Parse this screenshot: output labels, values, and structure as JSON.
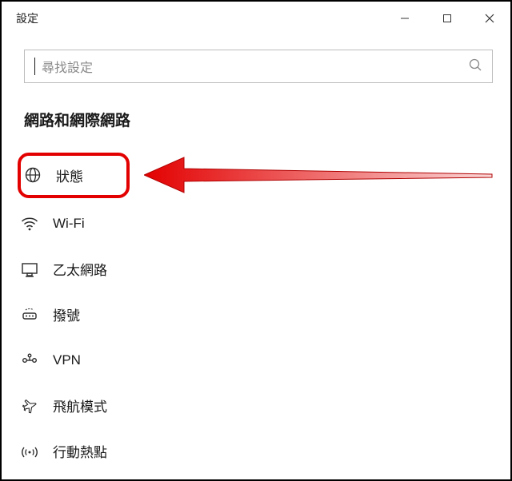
{
  "window": {
    "title": "設定"
  },
  "search": {
    "placeholder": "尋找設定"
  },
  "section": {
    "header": "網路和網際網路"
  },
  "menu": {
    "items": [
      {
        "label": "狀態"
      },
      {
        "label": "Wi-Fi"
      },
      {
        "label": "乙太網路"
      },
      {
        "label": "撥號"
      },
      {
        "label": "VPN"
      },
      {
        "label": "飛航模式"
      },
      {
        "label": "行動熱點"
      }
    ]
  }
}
